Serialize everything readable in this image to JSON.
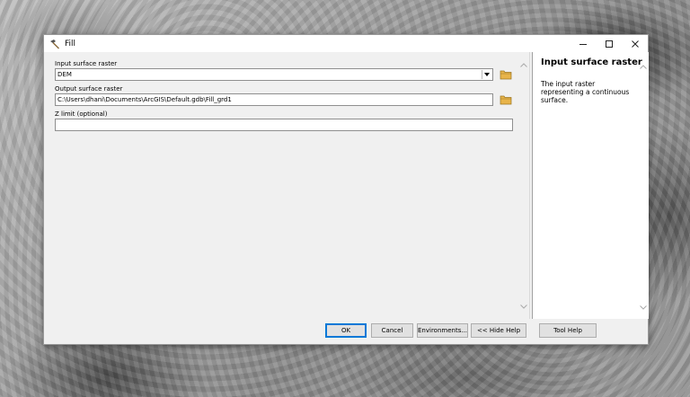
{
  "window": {
    "title": "Fill"
  },
  "form": {
    "input_label": "Input surface raster",
    "input_value": "DEM",
    "output_label": "Output surface raster",
    "output_value": "C:\\Users\\dhani\\Documents\\ArcGIS\\Default.gdb\\Fill_grd1",
    "zlimit_label": "Z limit (optional)",
    "zlimit_value": ""
  },
  "help": {
    "title": "Input surface raster",
    "text": "The input raster representing a continuous surface."
  },
  "buttons": {
    "ok": "OK",
    "cancel": "Cancel",
    "environments": "Environments...",
    "hide_help": "<< Hide Help",
    "tool_help": "Tool Help"
  },
  "colors": {
    "accent": "#0078d7",
    "panel": "#f0f0f0",
    "folder": "#e8b44a"
  },
  "icons": [
    "hammer-icon",
    "minimize-icon",
    "maximize-icon",
    "close-icon",
    "folder-icon",
    "chevron-down-icon",
    "chevron-up-icon"
  ]
}
